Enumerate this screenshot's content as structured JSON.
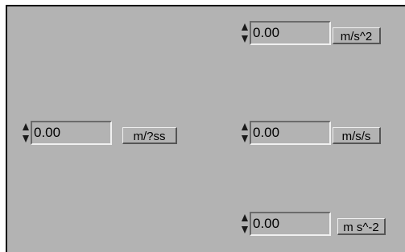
{
  "controls": [
    {
      "id": "left",
      "value": "0.00",
      "unit": "m/?ss"
    },
    {
      "id": "top-right",
      "value": "0.00",
      "unit": "m/s^2"
    },
    {
      "id": "mid-right",
      "value": "0.00",
      "unit": "m/s/s"
    },
    {
      "id": "bottom-right",
      "value": "0.00",
      "unit": "m s^-2"
    }
  ],
  "colors": {
    "panel": "#b3b3b3",
    "border": "#000000"
  }
}
